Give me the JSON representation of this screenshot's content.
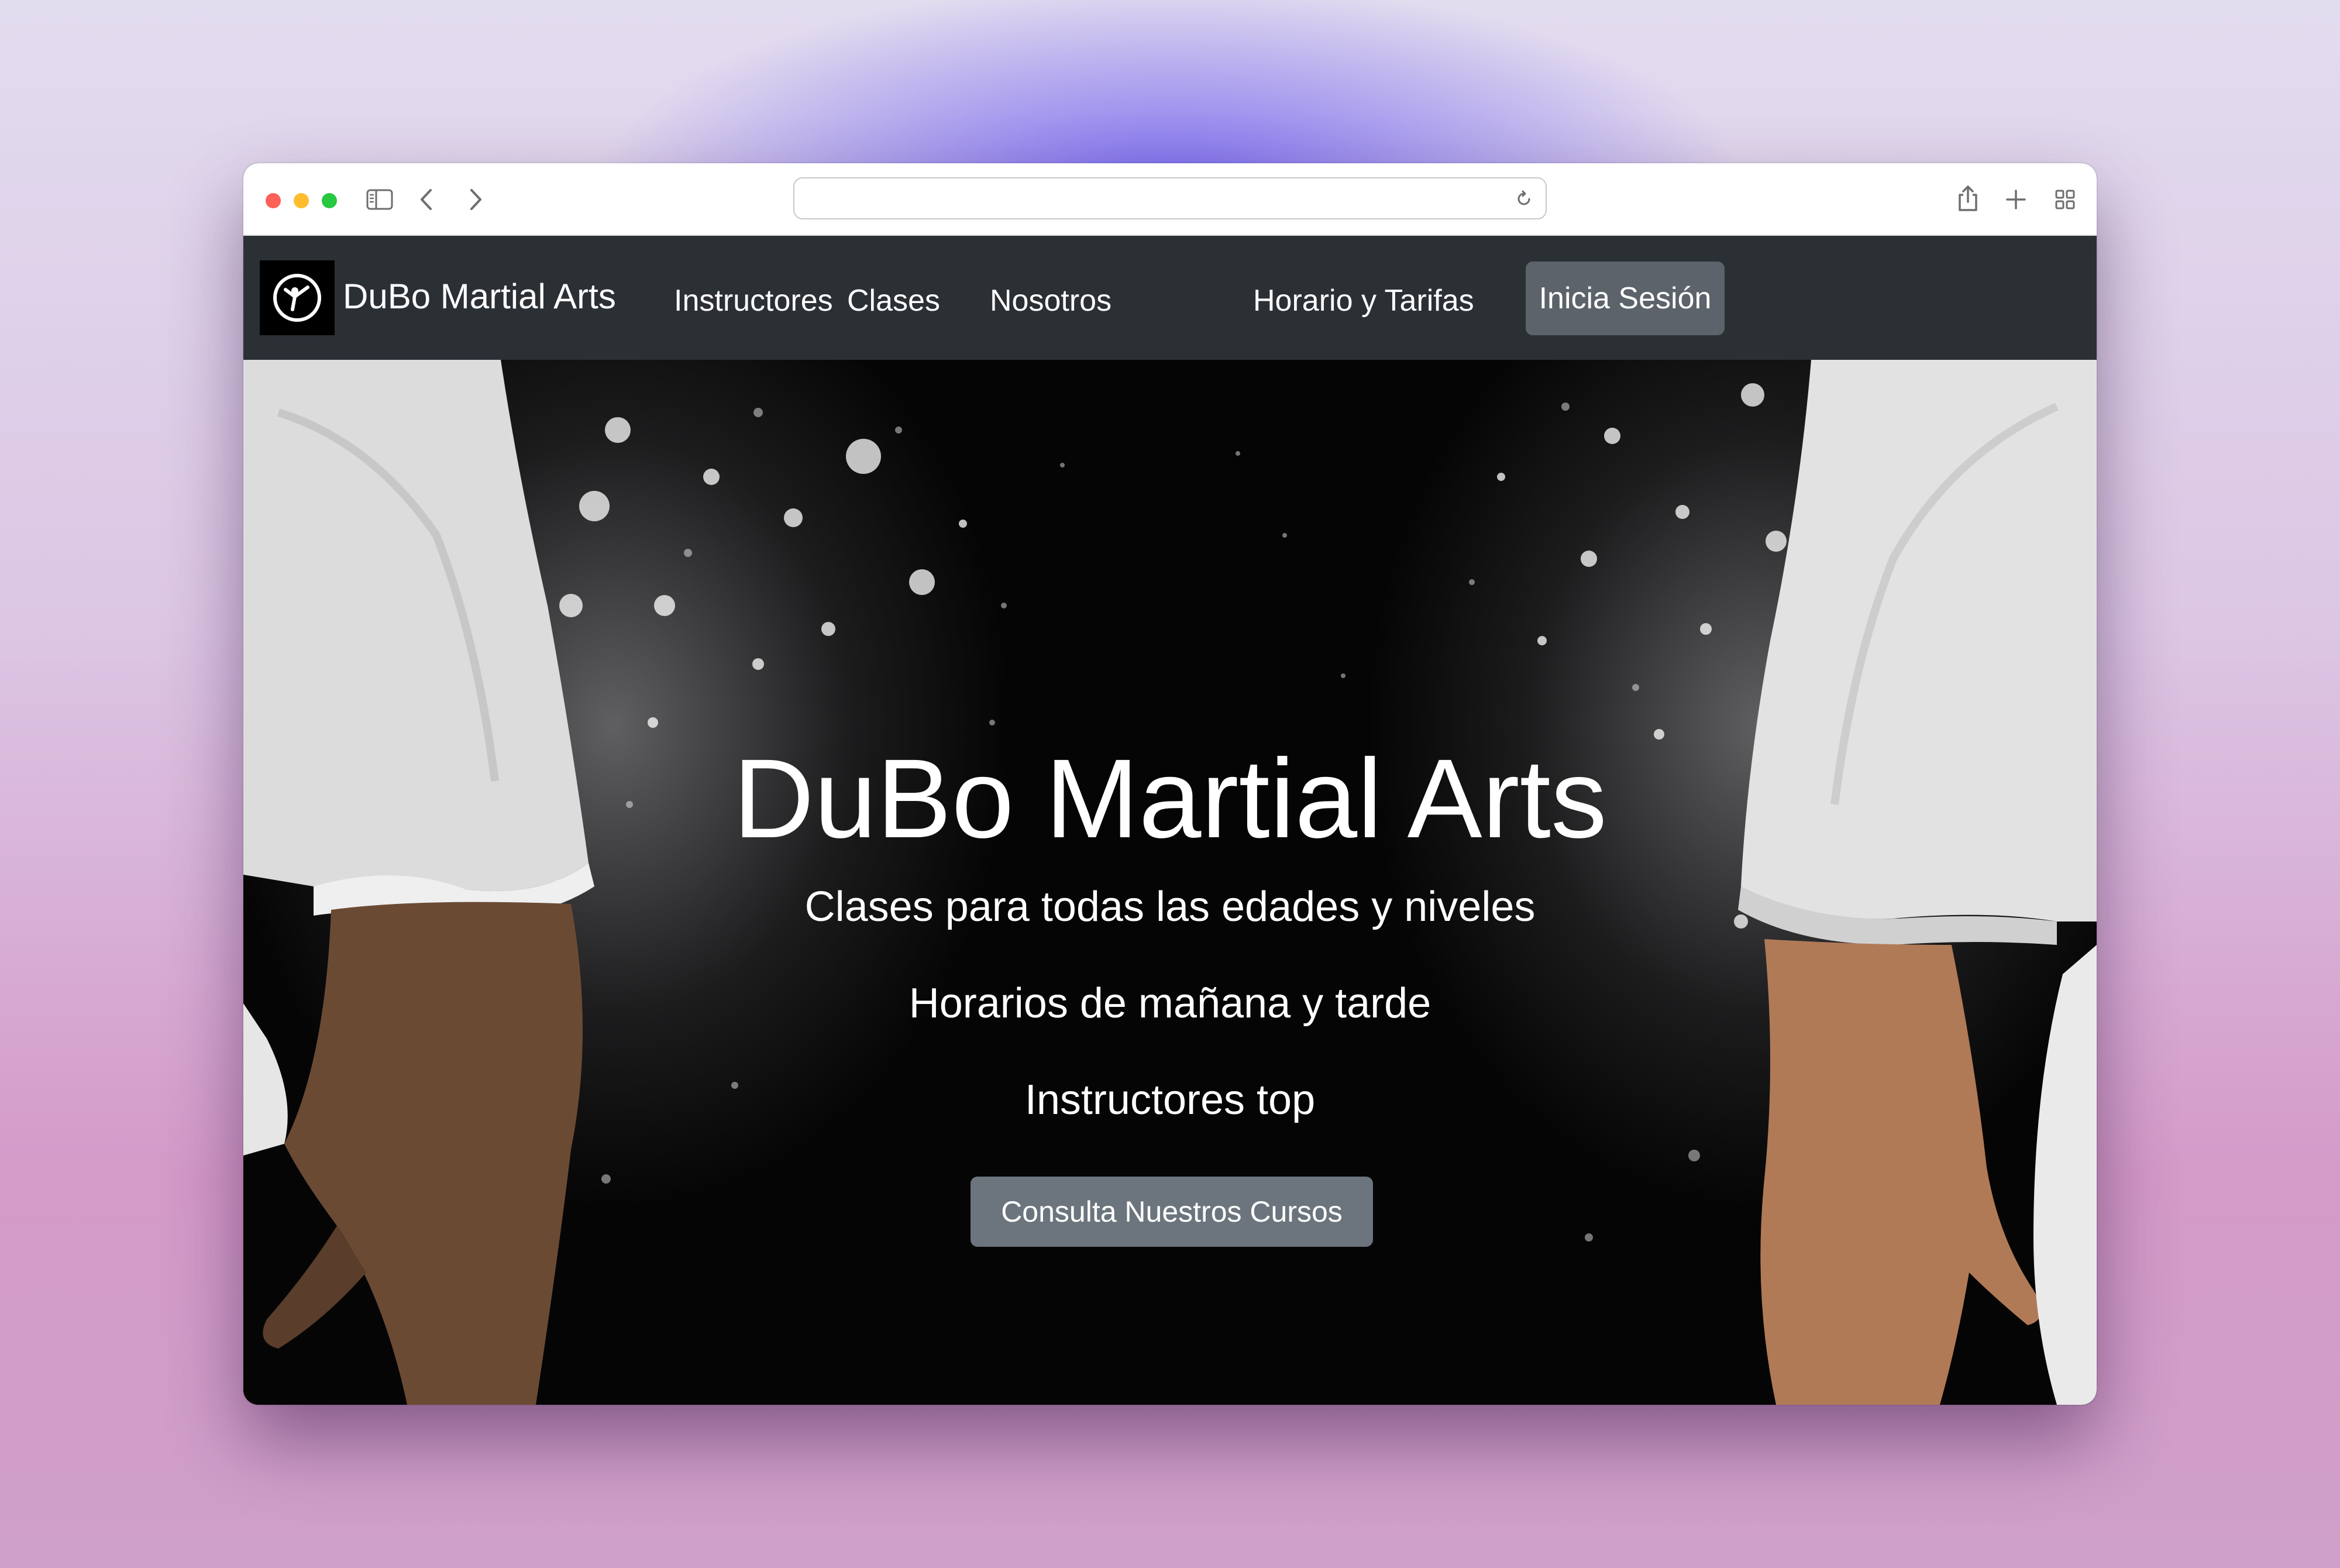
{
  "browser": {
    "icons": [
      "sidebar-icon",
      "back-chevron-icon",
      "forward-chevron-icon",
      "reload-icon",
      "share-icon",
      "new-tab-icon",
      "tab-overview-icon"
    ],
    "url": ""
  },
  "navbar": {
    "brand": "DuBo Martial Arts",
    "links": [
      "Instructores",
      "Clases",
      "Nosotros",
      "Horario y Tarifas"
    ],
    "login": "Inicia Sesión",
    "background": "#2b3035",
    "button_color": "#5c636a"
  },
  "hero": {
    "title": "DuBo Martial Arts",
    "lines": [
      "Clases para todas las edades y niveles",
      "Horarios de mañana y tarde",
      "Instructores top"
    ],
    "cta": "Consulta Nuestros Cursos",
    "cta_color": "#6c757d"
  }
}
